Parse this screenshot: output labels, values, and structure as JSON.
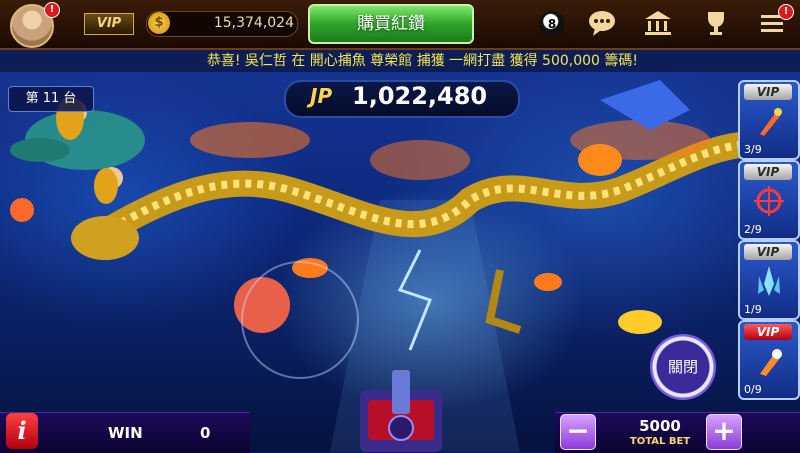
{
  "topbar": {
    "vip_label": "VIP",
    "coin_symbol": "$",
    "coins": "15,374,024",
    "buy_button": "購買紅鑽",
    "ball_label": "8",
    "avatar_badge": "!",
    "menu_badge": "!",
    "icons": [
      "avatar-icon",
      "coin-icon",
      "eight-ball-icon",
      "chat-icon",
      "bank-icon",
      "trophy-icon",
      "menu-icon"
    ]
  },
  "ticker": {
    "message": "恭喜! 吳仁哲 在 開心捕魚 尊榮館 捕獲 一網打盡 獲得 500,000 籌碼!"
  },
  "table": {
    "label": "第 11 台"
  },
  "jackpot": {
    "label": "JP",
    "value": "1,022,480"
  },
  "weapons": [
    {
      "vip": "VIP",
      "count": "3/9",
      "icon": "missile-icon"
    },
    {
      "vip": "VIP",
      "count": "2/9",
      "icon": "crosshair-icon"
    },
    {
      "vip": "VIP",
      "count": "1/9",
      "icon": "ice-crystal-icon"
    },
    {
      "vip": "VIP",
      "count": "0/9",
      "icon": "bomb-icon"
    }
  ],
  "close_button": "關閉",
  "bottom": {
    "info": "i",
    "win_label": "WIN",
    "win_value": "0",
    "bet_value": "5000",
    "bet_label": "TOTAL BET",
    "minus": "−",
    "plus": "+"
  },
  "colors": {
    "ticker_text": "#f2e64a",
    "buy_button": "#2fa42a",
    "jackpot_label": "#ffd34a",
    "ocean": "#1a3a9a"
  }
}
